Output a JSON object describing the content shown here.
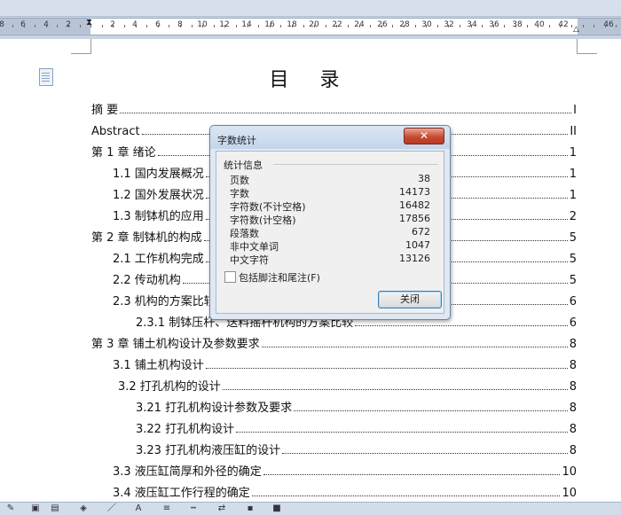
{
  "ruler": {
    "numbers": [
      "8",
      "6",
      "4",
      "2",
      "2",
      "4",
      "6",
      "8",
      "10",
      "12",
      "14",
      "16",
      "18",
      "20",
      "22",
      "24",
      "26",
      "28",
      "30",
      "32",
      "34",
      "36",
      "38",
      "40",
      "42",
      "46"
    ]
  },
  "document": {
    "toc_title": "目 录",
    "entries": [
      {
        "text": "摘    要",
        "page": "I"
      },
      {
        "text": "Abstract",
        "page": "II"
      },
      {
        "text": "第 1 章  绪论",
        "page": "1"
      },
      {
        "text": "1.1  国内发展概况",
        "page": "1"
      },
      {
        "text": "1.2  国外发展状况",
        "page": "1"
      },
      {
        "text": "1.3  制钵机的应用",
        "page": "2"
      },
      {
        "text": "第 2 章  制钵机的构成",
        "page": "5"
      },
      {
        "text": "2.1  工作机构完成",
        "page": "5"
      },
      {
        "text": "2.2  传动机构",
        "page": "5"
      },
      {
        "text": "2.3  机构的方案比较",
        "page": "6"
      },
      {
        "text": "2.3.1  制钵压杆、送料摇杆机构的方案比较",
        "page": "6"
      },
      {
        "text": "第 3 章  铺土机构设计及参数要求",
        "page": "8"
      },
      {
        "text": "3.1  铺土机构设计",
        "page": "8"
      },
      {
        "text": "3.2  打孔机构的设计",
        "page": "8"
      },
      {
        "text": "3.21  打孔机构设计参数及要求",
        "page": "8"
      },
      {
        "text": "3.22  打孔机构设计",
        "page": "8"
      },
      {
        "text": "3.23  打孔机构液压缸的设计",
        "page": "8"
      },
      {
        "text": "3.3  液压缸简厚和外径的确定",
        "page": "10"
      },
      {
        "text": "3.4  液压缸工作行程的确定",
        "page": "10"
      }
    ]
  },
  "dialog": {
    "title": "字数统计",
    "close_glyph": "✕",
    "group_label": "统计信息",
    "stats": [
      {
        "label": "页数",
        "value": "38"
      },
      {
        "label": "字数",
        "value": "14173"
      },
      {
        "label": "字符数(不计空格)",
        "value": "16482"
      },
      {
        "label": "字符数(计空格)",
        "value": "17856"
      },
      {
        "label": "段落数",
        "value": "672"
      },
      {
        "label": "非中文单词",
        "value": "1047"
      },
      {
        "label": "中文字符",
        "value": "13126"
      }
    ],
    "checkbox_label": "包括脚注和尾注(F)",
    "checkbox_checked": false,
    "close_button": "关闭"
  },
  "watermark": {
    "text": "文库",
    "url": "w w w . r e n r e n d o c . c o m"
  },
  "toolbar": {
    "icons": [
      "draw-icon",
      "picture-icon",
      "shape-icon",
      "fill-icon",
      "line-icon",
      "font-color-icon",
      "line-style-icon",
      "dash-style-icon",
      "arrow-style-icon",
      "shadow-icon",
      "3d-icon"
    ]
  }
}
